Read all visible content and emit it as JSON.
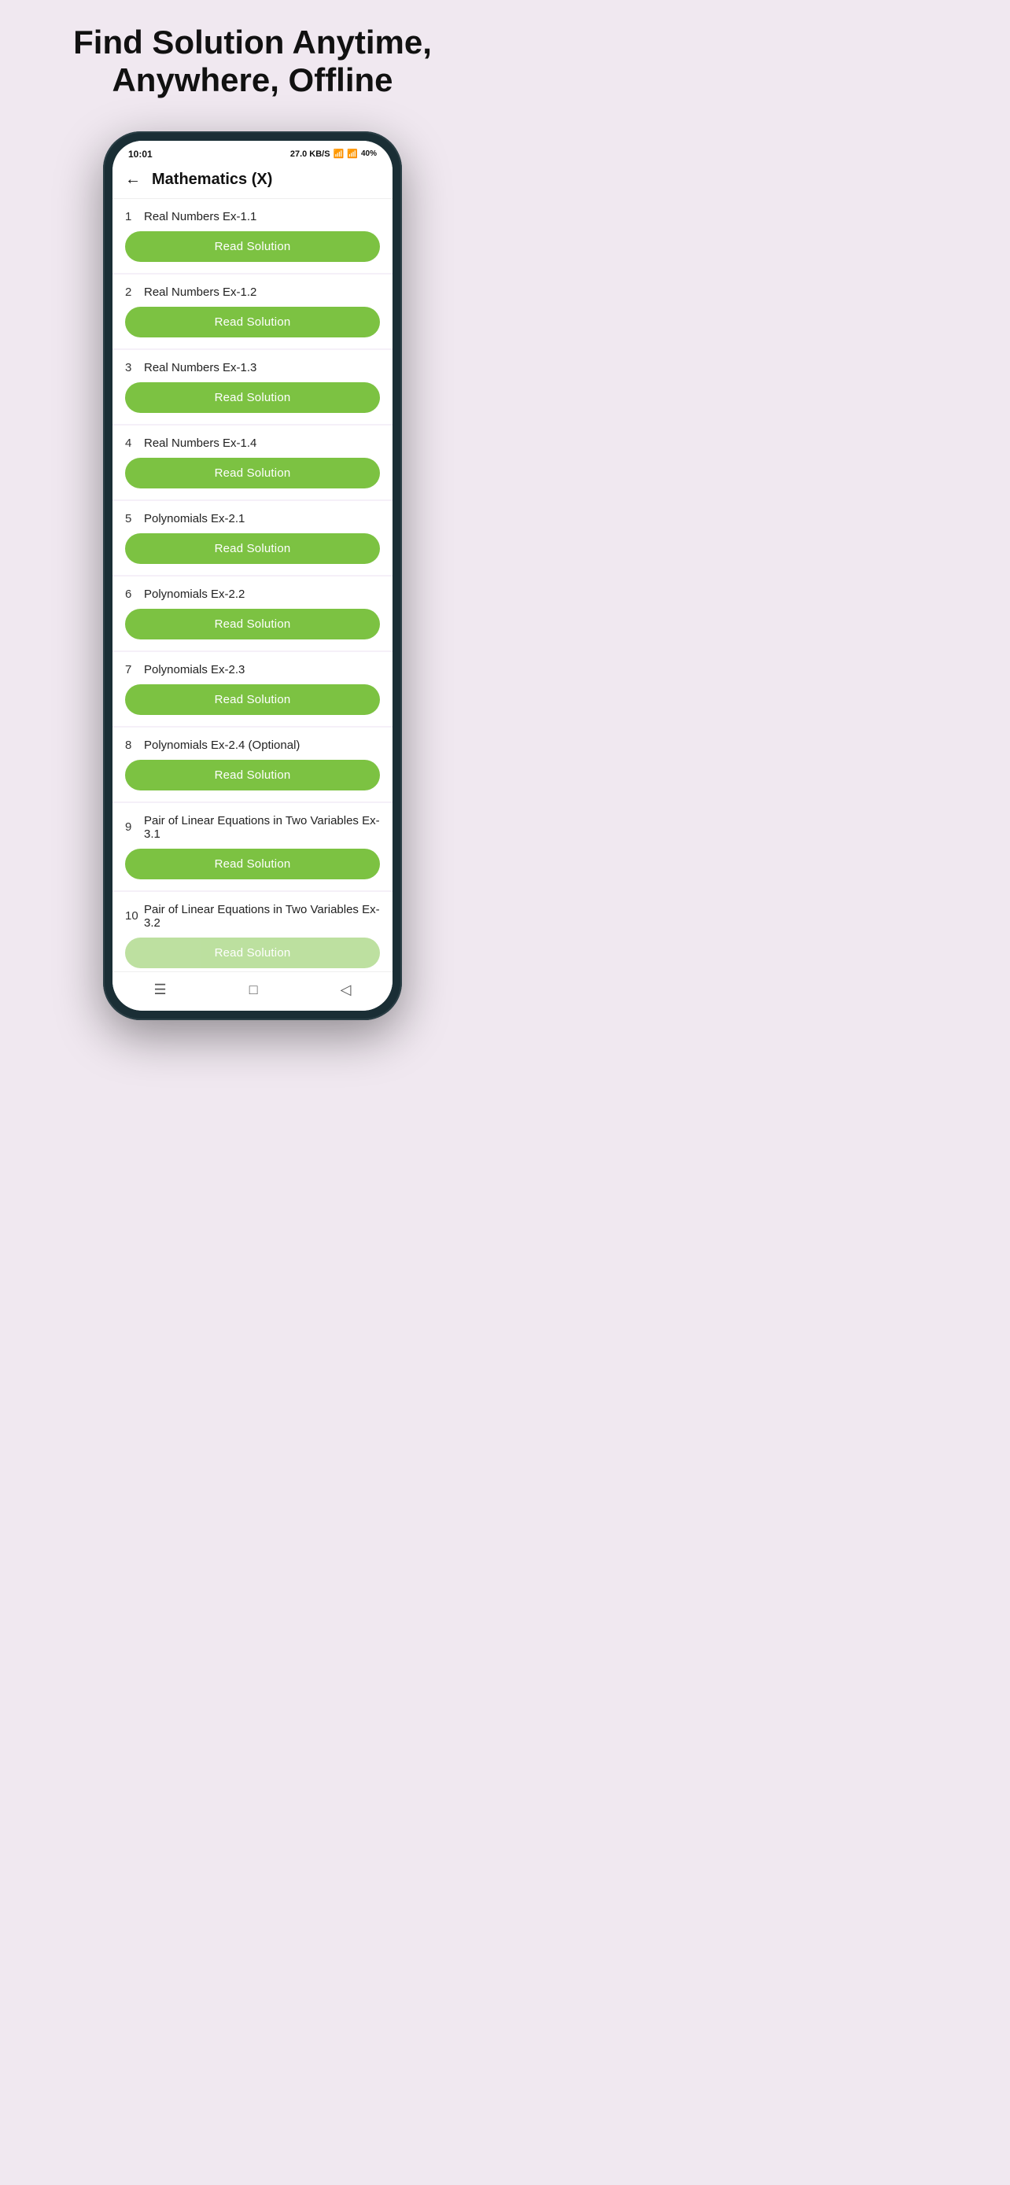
{
  "page": {
    "hero_title": "Find Solution Anytime, Anywhere, Offline",
    "status_bar": {
      "time": "10:01",
      "data_speed": "27.0 KB/S",
      "battery": "40%"
    },
    "nav": {
      "title": "Mathematics (X)",
      "back_label": "←"
    },
    "read_solution_label": "Read Solution",
    "list_items": [
      {
        "number": "1",
        "label": "Real Numbers Ex-1.1"
      },
      {
        "number": "2",
        "label": "Real Numbers Ex-1.2"
      },
      {
        "number": "3",
        "label": "Real Numbers Ex-1.3"
      },
      {
        "number": "4",
        "label": "Real Numbers Ex-1.4"
      },
      {
        "number": "5",
        "label": "Polynomials Ex-2.1"
      },
      {
        "number": "6",
        "label": "Polynomials Ex-2.2"
      },
      {
        "number": "7",
        "label": "Polynomials Ex-2.3"
      },
      {
        "number": "8",
        "label": "Polynomials Ex-2.4 (Optional)"
      },
      {
        "number": "9",
        "label": "Pair of Linear Equations in Two Variables Ex-3.1"
      },
      {
        "number": "10",
        "label": "Pair of Linear Equations in Two Variables Ex-3.2"
      }
    ],
    "bottom_nav": {
      "menu_icon": "☰",
      "home_icon": "□",
      "back_icon": "◁"
    }
  }
}
